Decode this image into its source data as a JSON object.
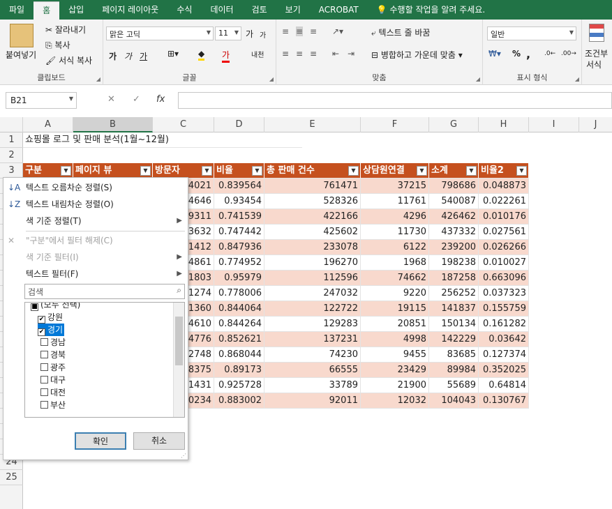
{
  "tabs": [
    "파일",
    "홈",
    "삽입",
    "페이지 레이아웃",
    "수식",
    "데이터",
    "검토",
    "보기",
    "ACROBAT",
    "💡 수행할 작업을 알려 주세요."
  ],
  "ribbon": {
    "clipboard": {
      "paste": "붙여넣기",
      "cut": "잘라내기",
      "copy": "복사",
      "format_painter": "서식 복사",
      "label": "클립보드"
    },
    "font": {
      "name": "맑은 고딕",
      "size": "11",
      "label": "글꼴",
      "grow": "가",
      "shrink": "가",
      "bold": "가",
      "italic": "가",
      "underline": "가",
      "hangul": "내천"
    },
    "alignment": {
      "wrap": "텍스트 줄 바꿈",
      "merge": "병합하고 가운데 맞춤",
      "label": "맞춤"
    },
    "number": {
      "format": "일반",
      "percent": "%",
      "comma": ",",
      "label": "표시 형식"
    },
    "cond": {
      "label1": "조건부",
      "label2": "서식"
    }
  },
  "formula_bar": {
    "namebox": "B21",
    "fx": "fx",
    "cancel": "✕",
    "enter": "✓",
    "value": ""
  },
  "col_headers": [
    "A",
    "B",
    "C",
    "D",
    "E",
    "F",
    "G",
    "H",
    "I",
    "J"
  ],
  "row_headers": [
    "1",
    "2",
    "3",
    "",
    "",
    "",
    "",
    "",
    "",
    "",
    "",
    "",
    "",
    "",
    "",
    "",
    "",
    "",
    "",
    "22",
    "23",
    "24",
    "25"
  ],
  "title_cell": "쇼핑몰 로그 및 판매 분석(1월~12월)",
  "table_headers": [
    "구분",
    "페이지 뷰",
    "방문자",
    "비율",
    "총 판매 건수",
    "상담원연결",
    "소계",
    "비율2"
  ],
  "rows": [
    [
      "4021",
      "0.839564",
      "761471",
      "37215",
      "798686",
      "0.048873"
    ],
    [
      "4646",
      "0.93454",
      "528326",
      "11761",
      "540087",
      "0.022261"
    ],
    [
      "9311",
      "0.741539",
      "422166",
      "4296",
      "426462",
      "0.010176"
    ],
    [
      "3632",
      "0.747442",
      "425602",
      "11730",
      "437332",
      "0.027561"
    ],
    [
      "1412",
      "0.847936",
      "233078",
      "6122",
      "239200",
      "0.026266"
    ],
    [
      "4861",
      "0.774952",
      "196270",
      "1968",
      "198238",
      "0.010027"
    ],
    [
      "1803",
      "0.95979",
      "112596",
      "74662",
      "187258",
      "0.663096"
    ],
    [
      "1274",
      "0.778006",
      "247032",
      "9220",
      "256252",
      "0.037323"
    ],
    [
      "1360",
      "0.844064",
      "122722",
      "19115",
      "141837",
      "0.155759"
    ],
    [
      "4610",
      "0.844264",
      "129283",
      "20851",
      "150134",
      "0.161282"
    ],
    [
      "4776",
      "0.852621",
      "137231",
      "4998",
      "142229",
      "0.03642"
    ],
    [
      "2748",
      "0.868044",
      "74230",
      "9455",
      "83685",
      "0.127374"
    ],
    [
      "8375",
      "0.89173",
      "66555",
      "23429",
      "89984",
      "0.352025"
    ],
    [
      "1431",
      "0.925728",
      "33789",
      "21900",
      "55689",
      "0.64814"
    ],
    [
      "0234",
      "0.883002",
      "92011",
      "12032",
      "104043",
      "0.130767"
    ]
  ],
  "filter_menu": {
    "sort_asc": "텍스트 오름차순 정렬(S)",
    "sort_desc": "텍스트 내림차순 정렬(O)",
    "sort_color": "색 기준 정렬(T)",
    "clear_filter": "\"구분\"에서 필터 해제(C)",
    "filter_color": "색 기준 필터(I)",
    "text_filter": "텍스트 필터(F)",
    "search_placeholder": "검색",
    "items": [
      {
        "label": "(모두 선택)",
        "checked": "■"
      },
      {
        "label": "강원",
        "checked": "✔"
      },
      {
        "label": "경기",
        "checked": "✔"
      },
      {
        "label": "경남",
        "checked": ""
      },
      {
        "label": "경북",
        "checked": ""
      },
      {
        "label": "광주",
        "checked": ""
      },
      {
        "label": "대구",
        "checked": ""
      },
      {
        "label": "대전",
        "checked": ""
      },
      {
        "label": "부산",
        "checked": ""
      }
    ],
    "ok": "확인",
    "cancel": "취소"
  }
}
